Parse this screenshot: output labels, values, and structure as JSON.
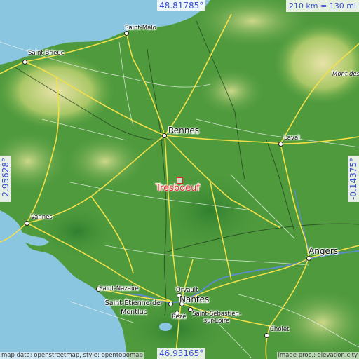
{
  "location": {
    "name": "Tresboeuf",
    "marker_color": "#e0302a"
  },
  "coordinates": {
    "top_lat": "48.81785°",
    "bottom_lat": "46.93165°",
    "left_lon": "-2.95628°",
    "right_lon": "-0.14375°"
  },
  "scale": "210 km = 130 mi",
  "cities": [
    {
      "name": "Saint-Malo",
      "size": "small"
    },
    {
      "name": "Saint-Brieuc",
      "size": "small"
    },
    {
      "name": "Rennes",
      "size": "big"
    },
    {
      "name": "Laval",
      "size": "small"
    },
    {
      "name": "Vannes",
      "size": "small"
    },
    {
      "name": "Angers",
      "size": "big"
    },
    {
      "name": "Saint-Nazaire",
      "size": "small"
    },
    {
      "name": "Orvault",
      "size": "small"
    },
    {
      "name": "Nantes",
      "size": "big"
    },
    {
      "name": "Saint-Étienne-de-Montluc",
      "size": "med"
    },
    {
      "name": "Rezé",
      "size": "small"
    },
    {
      "name": "Saint-Sébastien-sur-Loire",
      "size": "small"
    },
    {
      "name": "Cholet",
      "size": "small"
    },
    {
      "name": "Mont des Avaloirs",
      "size": "italic"
    }
  ],
  "attribution": {
    "left": "map data: openstreetmap, style: opentopomap",
    "right": "image proc.: elevation.city"
  },
  "colors": {
    "sea": "#8ac6e0",
    "land": "#4f9a3d",
    "highlands": "#d4d79a",
    "roads": "#f2e04a",
    "coord_text": "#3a4fd4"
  }
}
